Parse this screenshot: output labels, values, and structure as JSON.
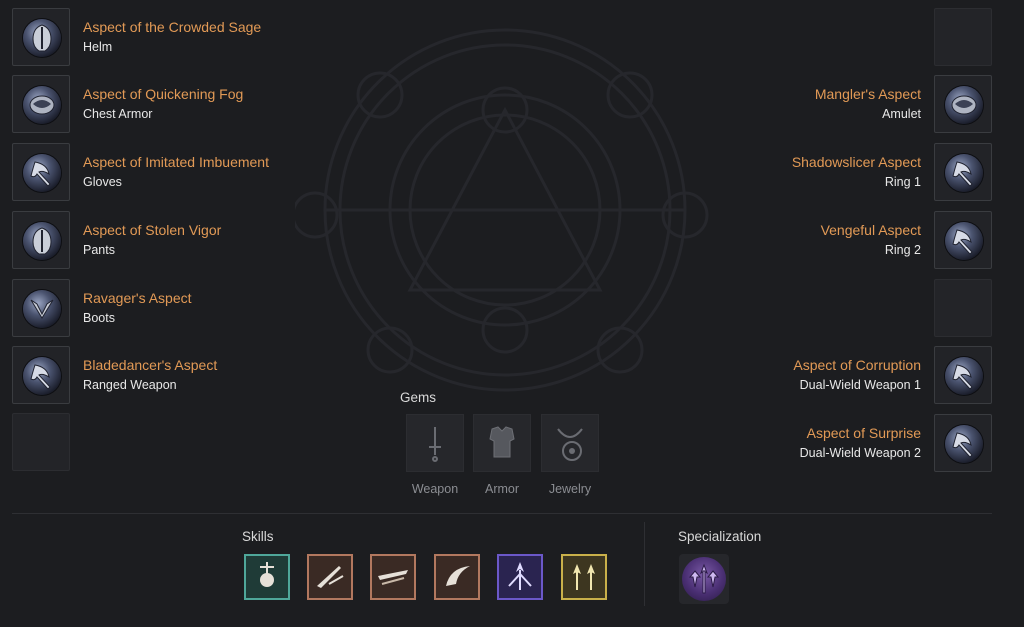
{
  "left_aspects": [
    {
      "name": "Aspect of the Crowded Sage",
      "slot": "Helm",
      "icon": "helm-aspect-icon"
    },
    {
      "name": "Aspect of Quickening Fog",
      "slot": "Chest Armor",
      "icon": "chest-aspect-icon"
    },
    {
      "name": "Aspect of Imitated Imbuement",
      "slot": "Gloves",
      "icon": "axe-aspect-icon"
    },
    {
      "name": "Aspect of Stolen Vigor",
      "slot": "Pants",
      "icon": "helm-aspect-icon"
    },
    {
      "name": "Ravager's Aspect",
      "slot": "Boots",
      "icon": "wing-aspect-icon"
    },
    {
      "name": "Bladedancer's Aspect",
      "slot": "Ranged Weapon",
      "icon": "axe-aspect-icon"
    }
  ],
  "right_aspects": [
    {
      "name": "Mangler's Aspect",
      "slot": "Amulet",
      "icon": "chest-aspect-icon"
    },
    {
      "name": "Shadowslicer Aspect",
      "slot": "Ring 1",
      "icon": "axe-aspect-icon"
    },
    {
      "name": "Vengeful Aspect",
      "slot": "Ring 2",
      "icon": "axe-aspect-icon"
    },
    {
      "name": "Aspect of Corruption",
      "slot": "Dual-Wield Weapon 1",
      "icon": "axe-aspect-icon"
    },
    {
      "name": "Aspect of Surprise",
      "slot": "Dual-Wield Weapon 2",
      "icon": "axe-aspect-icon"
    }
  ],
  "gems": {
    "title": "Gems",
    "items": [
      {
        "label": "Weapon",
        "icon": "dagger-icon"
      },
      {
        "label": "Armor",
        "icon": "armor-icon"
      },
      {
        "label": "Jewelry",
        "icon": "amulet-icon"
      }
    ]
  },
  "skills": {
    "title": "Skills",
    "items": [
      {
        "icon": "skull-trap-skill-icon",
        "color": "#4fa79a"
      },
      {
        "icon": "blade-skill-icon",
        "color": "#b2785f"
      },
      {
        "icon": "dash-skill-icon",
        "color": "#b2785f"
      },
      {
        "icon": "claw-skill-icon",
        "color": "#b2785f"
      },
      {
        "icon": "arrow-burst-skill-icon",
        "color": "#6b58c9"
      },
      {
        "icon": "twin-arrow-skill-icon",
        "color": "#c9b04a"
      }
    ]
  },
  "specialization": {
    "title": "Specialization",
    "icon": "combo-specialization-icon"
  }
}
